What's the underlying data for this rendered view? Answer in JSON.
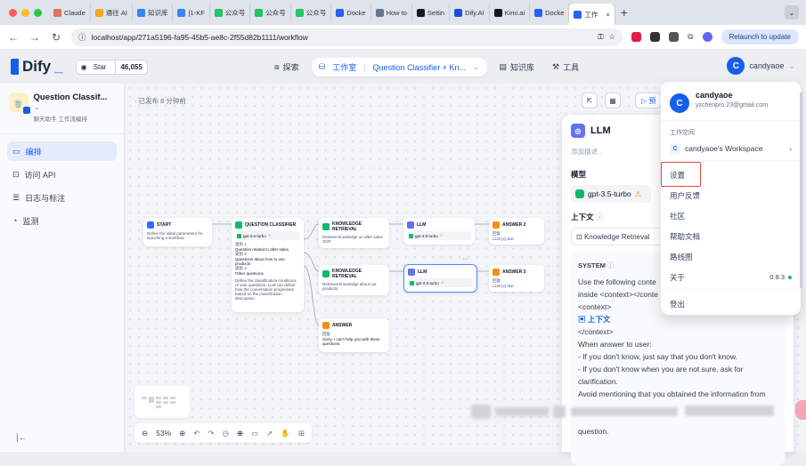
{
  "browser": {
    "tabs": [
      {
        "label": "Claude",
        "color": "#d97757"
      },
      {
        "label": "通往 AI",
        "color": "#f5a623"
      },
      {
        "label": "知识库",
        "color": "#3b82f6"
      },
      {
        "label": "[1-KF",
        "color": "#3b82f6"
      },
      {
        "label": "公众号",
        "color": "#22c55e"
      },
      {
        "label": "公众号",
        "color": "#22c55e"
      },
      {
        "label": "公众号",
        "color": "#22c55e"
      },
      {
        "label": "Docke",
        "color": "#2563eb"
      },
      {
        "label": "How to",
        "color": "#64748b"
      },
      {
        "label": "Settin",
        "color": "#111827"
      },
      {
        "label": "Dify.AI",
        "color": "#1d4ed8"
      },
      {
        "label": "Kimi.ai",
        "color": "#111827"
      },
      {
        "label": "Docke",
        "color": "#2563eb"
      },
      {
        "label": "工作",
        "color": "#2563eb"
      }
    ],
    "active_tab_index": 13,
    "url": "localhost/app/271a5196-fa95-45b5-ae8c-2f55d82b1111/workflow",
    "relaunch_label": "Relaunch to update"
  },
  "header": {
    "logo": "Dify",
    "github_star_label": "Star",
    "github_star_count": "46,055",
    "nav": {
      "explore": "探索",
      "studio": "工作室",
      "breadcrumb": "Question Classifier + Kn...",
      "knowledge": "知识库",
      "tools": "工具"
    },
    "user": {
      "initial": "C",
      "name": "candyaoe"
    }
  },
  "sidebar": {
    "app_name": "Question Classif...",
    "app_tags": "聊天助手   工作流编排",
    "items": [
      {
        "label": "编排",
        "icon": "layout-icon",
        "active": true
      },
      {
        "label": "访问 API",
        "icon": "terminal-icon",
        "active": false
      },
      {
        "label": "日志与标注",
        "icon": "file-list-icon",
        "active": false
      },
      {
        "label": "监测",
        "icon": "monitor-icon",
        "active": false
      }
    ]
  },
  "canvas": {
    "published_text": "· 已发布 8 分钟前",
    "preview_label": "预",
    "zoom": "53%",
    "nodes": {
      "start": {
        "title": "START",
        "desc": "Define the initial parameters for launching a workflow"
      },
      "classifier": {
        "title": "QUESTION CLASSIFIER",
        "model": "gpt-3.5-turbo",
        "c1_label": "类别 1",
        "c1": "Question related to after sales",
        "c2_label": "类别 2",
        "c2": "Questions about how to use products",
        "c3_label": "类别 3",
        "c3": "Other questions",
        "desc": "Define the classification conditions of user questions, LLM can define how the conversation progresses based on the classification description."
      },
      "kr1": {
        "title": "KNOWLEDGE RETRIEVAL",
        "desc": "Retrieve knowledge on after sales SOP."
      },
      "kr2": {
        "title": "KNOWLEDGE RETRIEVAL",
        "desc": "Retrieval knowledge about out products."
      },
      "llm1": {
        "title": "LLM",
        "model": "gpt-3.5-turbo"
      },
      "llm2": {
        "title": "LLM",
        "model": "gpt-3.5-turbo"
      },
      "ans2": {
        "title": "ANSWER 2",
        "l1": "回复",
        "l2": "LLM",
        "l3": "{x} text"
      },
      "ans3": {
        "title": "ANSWER 3",
        "l1": "回复",
        "l2": "LLM",
        "l3": "{x} text"
      },
      "ans": {
        "title": "ANSWER",
        "l1": "回复",
        "l2": "Sorry, I can't help you with these questions."
      }
    }
  },
  "panel": {
    "title": "LLM",
    "desc_placeholder": "添加描述...",
    "model_label": "模型",
    "model_value": "gpt-3.5-turbo",
    "context_label": "上下文",
    "context_value": "Knowledge Retrieval",
    "system_label": "SYSTEM",
    "system_lines": [
      "Use the following conte",
      "inside <context></conte",
      "<context>",
      "上下文",
      "</context>",
      "When answer to user:",
      "- If you don't know, just say that you don't know.",
      "- If you don't know when you are not sure, ask for",
      "clarification.",
      "Avoid mentioning that you obtained the information from",
      "",
      "",
      "question."
    ]
  },
  "dropdown": {
    "name": "candyaoe",
    "email": "yzchenpro.23@gmail.com",
    "workspace_section": "工作空间",
    "workspace_initial": "C",
    "workspace_name": "candyaoe's Workspace",
    "items": {
      "settings": "设置",
      "feedback": "用户反馈",
      "community": "社区",
      "docs": "帮助文档",
      "roadmap": "路线图",
      "about": "关于",
      "logout": "登出"
    },
    "version": "0.8.3"
  }
}
